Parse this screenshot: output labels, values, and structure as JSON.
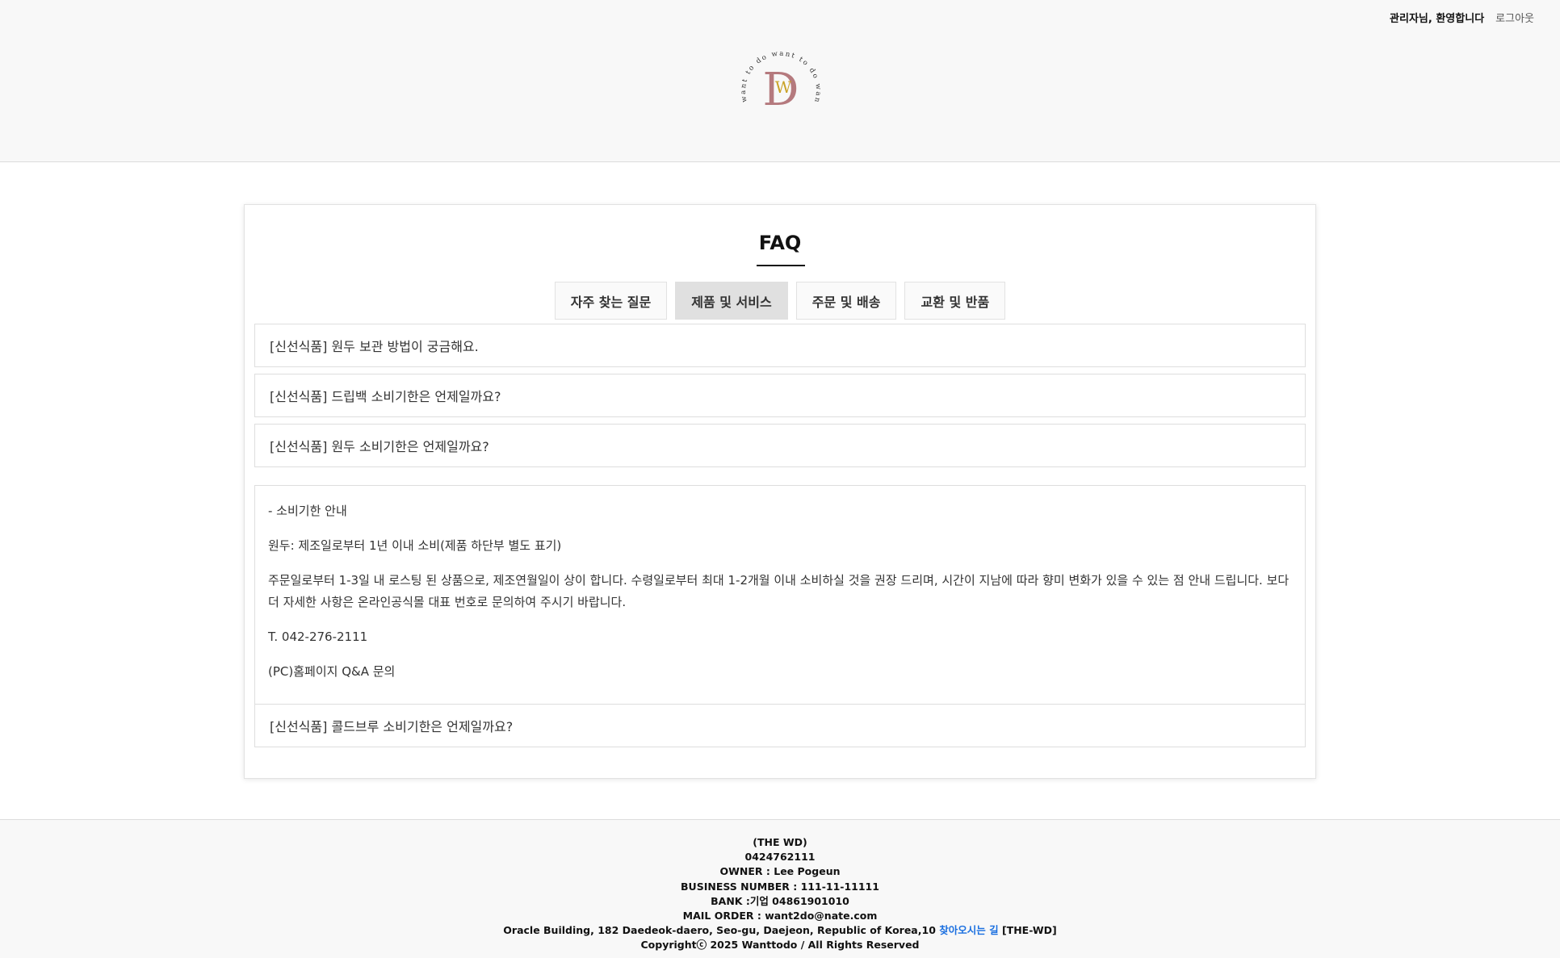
{
  "header": {
    "welcome": "관리자님, 환영합니다",
    "logout": "로그아웃",
    "logo_ring_text": "want to do want to do want to do"
  },
  "faq": {
    "title": "FAQ",
    "tabs": [
      {
        "label": "자주 찾는 질문",
        "active": false
      },
      {
        "label": "제품 및 서비스",
        "active": true
      },
      {
        "label": "주문 및 배송",
        "active": false
      },
      {
        "label": "교환 및 반품",
        "active": false
      }
    ],
    "questions": [
      "[신선식품] 원두 보관 방법이 궁금해요.",
      "[신선식품] 드립백 소비기한은 언제일까요?",
      "[신선식품] 원두 소비기한은 언제일까요?",
      "[신선식품] 콜드브루 소비기한은 언제일까요?"
    ],
    "answer": {
      "heading": "- 소비기한 안내",
      "line1": "원두: 제조일로부터 1년 이내 소비(제품 하단부 별도 표기)",
      "line2": "주문일로부터 1-3일 내 로스팅 된 상품으로, 제조연월일이 상이 합니다. 수령일로부터 최대 1-2개월 이내 소비하실 것을 권장 드리며, 시간이 지남에 따라 향미 변화가 있을 수 있는 점 안내 드립니다. 보다 더 자세한 사항은 온라인공식몰 대표 번호로 문의하여 주시기 바랍니다.",
      "phone": "T. 042-276-2111",
      "qna": "(PC)홈페이지 Q&A 문의"
    }
  },
  "footer": {
    "company": "(THE WD)",
    "phone": "0424762111",
    "owner": "OWNER : Lee Pogeun",
    "business": "BUSINESS NUMBER : 111-11-11111",
    "bank": "BANK :기업 04861901010",
    "mail": "MAIL ORDER : want2do@nate.com",
    "address": "Oracle Building, 182 Daedeok-daero, Seo-gu, Daejeon, Republic of Korea,10",
    "directions_link": "찾아오시는 길",
    "brand_tag": "[THE-WD]",
    "copyright": "Copyrightⓒ 2025 Wanttodo / All Rights Reserved"
  },
  "colors": {
    "logo_letter": "#b57a7e",
    "logo_w": "#c9a227",
    "link": "#1a6fe0",
    "active_tab": "#e0e0e0"
  }
}
